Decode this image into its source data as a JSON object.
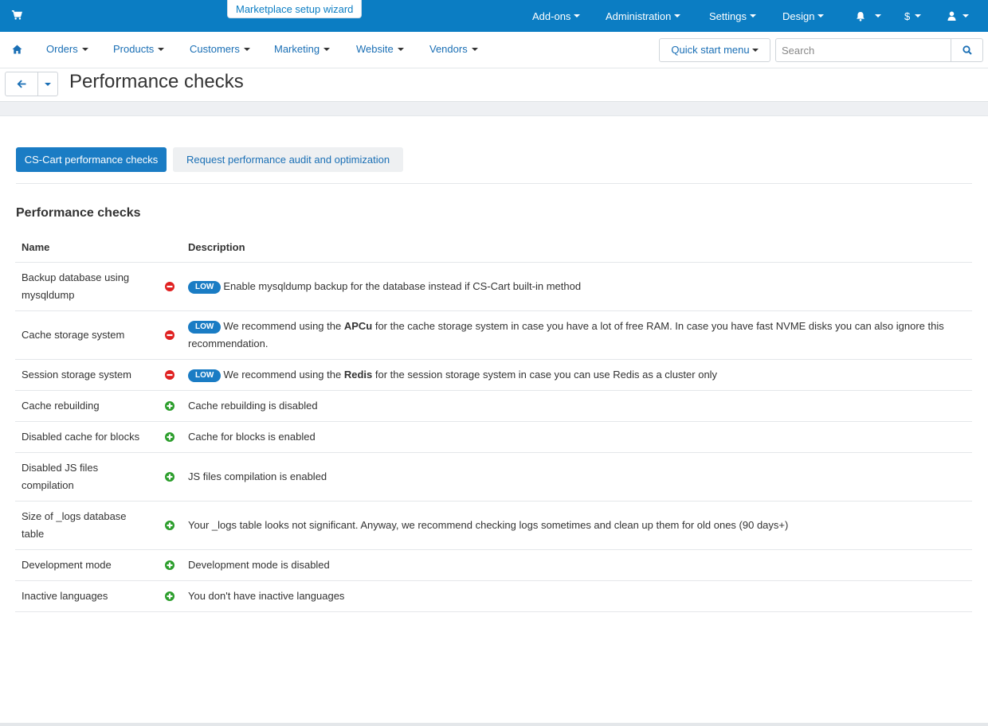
{
  "topbar": {
    "wizard_label": "Marketplace setup wizard",
    "menus": [
      "Add-ons",
      "Administration",
      "Settings",
      "Design"
    ],
    "currency": "$"
  },
  "mainnav": {
    "items": [
      "Orders",
      "Products",
      "Customers",
      "Marketing",
      "Website",
      "Vendors"
    ],
    "quick_start": "Quick start menu",
    "search_placeholder": "Search"
  },
  "page": {
    "title": "Performance checks"
  },
  "tabs": {
    "active": "CS-Cart performance checks",
    "other": "Request performance audit and optimization"
  },
  "section": {
    "title": "Performance checks",
    "col_name": "Name",
    "col_description": "Description"
  },
  "badge_label": "LOW",
  "rows": [
    {
      "name": "Backup database using mysqldump",
      "status": "fail",
      "pre": "Enable mysqldump backup for the database instead if CS-Cart built-in method",
      "bold": "",
      "post": ""
    },
    {
      "name": "Cache storage system",
      "status": "fail",
      "pre": "We recommend using the ",
      "bold": "APCu",
      "post": " for the cache storage system in case you have a lot of free RAM. In case you have fast NVME disks you can also ignore this recommendation."
    },
    {
      "name": "Session storage system",
      "status": "fail",
      "pre": "We recommend using the ",
      "bold": "Redis",
      "post": " for the session storage system in case you can use Redis as a cluster only"
    },
    {
      "name": "Cache rebuilding",
      "status": "ok",
      "pre": "Cache rebuilding is disabled",
      "bold": "",
      "post": ""
    },
    {
      "name": "Disabled cache for blocks",
      "status": "ok",
      "pre": "Cache for blocks is enabled",
      "bold": "",
      "post": ""
    },
    {
      "name": "Disabled JS files compilation",
      "status": "ok",
      "pre": "JS files compilation is enabled",
      "bold": "",
      "post": ""
    },
    {
      "name": "Size of _logs database table",
      "status": "ok",
      "pre": "Your _logs table looks not significant. Anyway, we recommend checking logs sometimes and clean up them for old ones (90 days+)",
      "bold": "",
      "post": ""
    },
    {
      "name": "Development mode",
      "status": "ok",
      "pre": "Development mode is disabled",
      "bold": "",
      "post": ""
    },
    {
      "name": "Inactive languages",
      "status": "ok",
      "pre": "You don't have inactive languages",
      "bold": "",
      "post": ""
    }
  ],
  "colors": {
    "topbar": "#0b7dc3",
    "accent": "#1a7cc4",
    "fail": "#e02020",
    "ok": "#2a9d2a"
  },
  "icons": {
    "cart": "cart-icon",
    "home": "home-icon",
    "bell": "bell-icon",
    "user": "user-icon",
    "back": "arrow-left-icon",
    "search": "search-icon",
    "fail": "minus-circle-icon",
    "ok": "plus-circle-icon"
  }
}
